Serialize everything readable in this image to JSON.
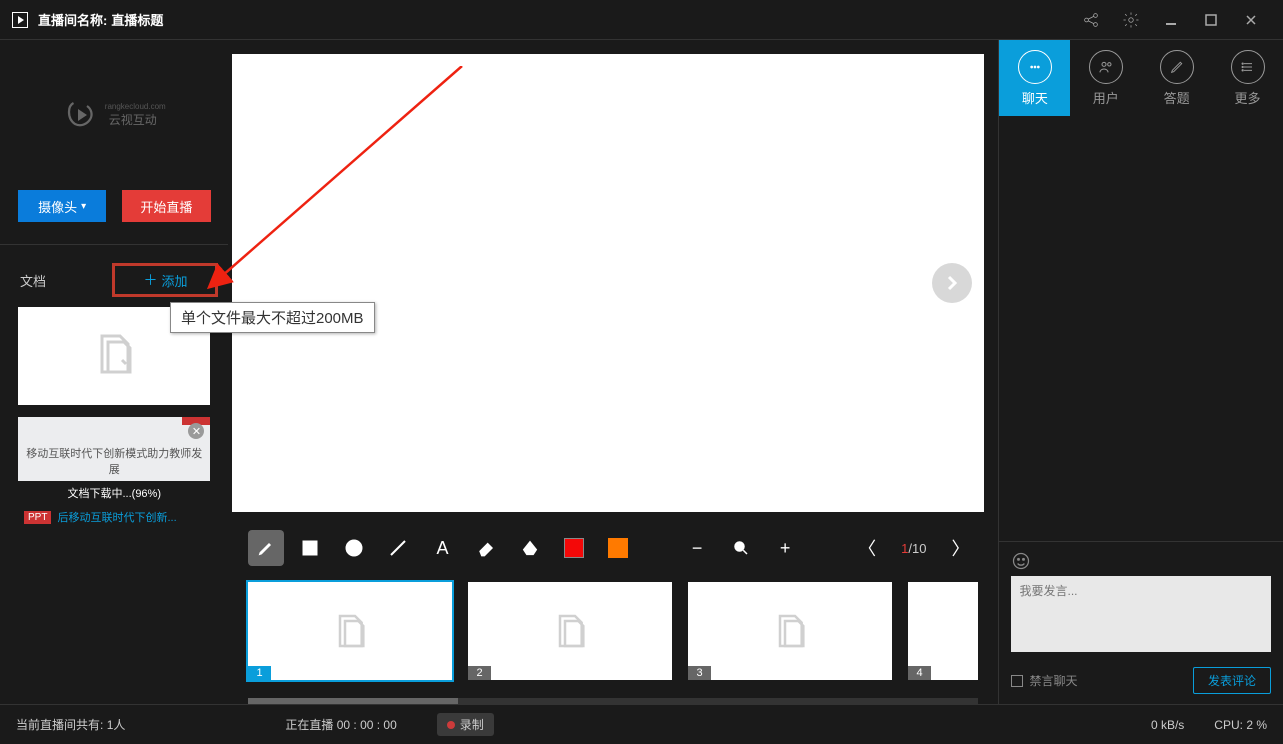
{
  "titlebar": {
    "label": "直播间名称:",
    "value": "直播标题"
  },
  "logo": {
    "brand": "云视互动",
    "sub": "rangkecloud.com"
  },
  "sidebar": {
    "camera_btn": "摄像头",
    "start_btn": "开始直播",
    "docs_label": "文档",
    "add_label": "添加"
  },
  "tooltip": "单个文件最大不超过200MB",
  "doc_thumb2": {
    "line": "移动互联时代下创新模式助力教师发展",
    "progress": "文档下载中...(96%)",
    "tag": "PPT",
    "title": "后移动互联时代下创新..."
  },
  "toolbar": {
    "colors": {
      "red": "#f40808",
      "orange": "#ff7a00"
    }
  },
  "pager": {
    "current": "1",
    "total": "10"
  },
  "slides": [
    {
      "n": "1"
    },
    {
      "n": "2"
    },
    {
      "n": "3"
    },
    {
      "n": "4"
    }
  ],
  "tabs": {
    "chat": "聊天",
    "user": "用户",
    "quiz": "答题",
    "more": "更多"
  },
  "chat": {
    "placeholder": "我要发言...",
    "mute": "禁言聊天",
    "send": "发表评论"
  },
  "status": {
    "viewers_label": "当前直播间共有:",
    "viewers": "1人",
    "live_label": "正在直播",
    "time": "00 : 00 : 00",
    "record": "录制",
    "net": "0 kB/s",
    "cpu_label": "CPU:",
    "cpu": "2 %"
  }
}
